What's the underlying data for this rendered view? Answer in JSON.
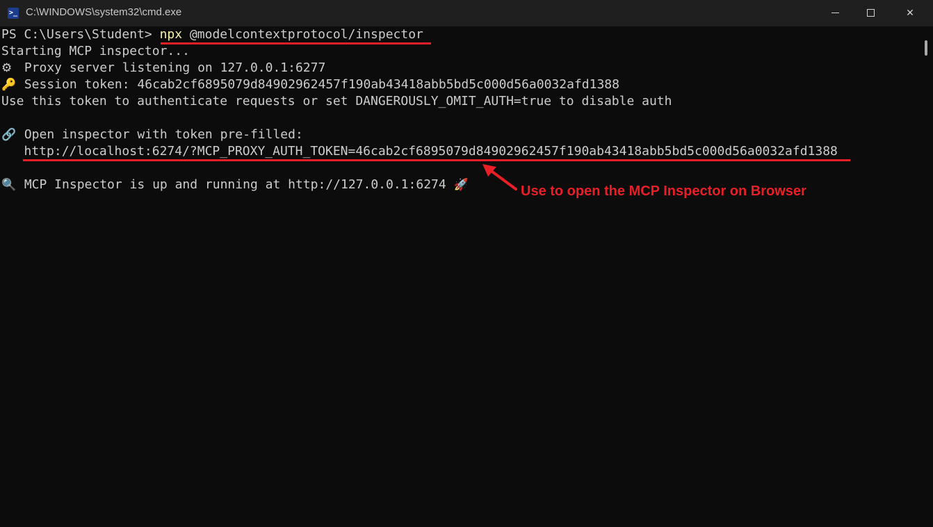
{
  "window": {
    "title": "C:\\WINDOWS\\system32\\cmd.exe",
    "app_icon": "powershell-icon",
    "controls": {
      "minimize": "minimize-icon",
      "maximize": "maximize-icon",
      "close_glyph": "✕"
    }
  },
  "console": {
    "prompt": "PS C:\\Users\\Student> ",
    "command_npx": "npx",
    "command_rest": " @modelcontextprotocol/inspector",
    "line_starting": "Starting MCP inspector...",
    "proxy_icon": "⚙",
    "line_proxy": " Proxy server listening on 127.0.0.1:6277",
    "key_icon": "🔑",
    "line_token": " Session token: 46cab2cf6895079d84902962457f190ab43418abb5bd5c000d56a0032afd1388",
    "line_use_token": "Use this token to authenticate requests or set DANGEROUSLY_OMIT_AUTH=true to disable auth",
    "link_icon": "🔗",
    "line_open": " Open inspector with token pre-filled:",
    "line_url": "   http://localhost:6274/?MCP_PROXY_AUTH_TOKEN=46cab2cf6895079d84902962457f190ab43418abb5bd5c000d56a0032afd1388",
    "search_icon": "🔍",
    "line_running": " MCP Inspector is up and running at http://127.0.0.1:6274 ",
    "rocket_icon": "🚀"
  },
  "annotation": {
    "text": "Use to open the MCP Inspector on Browser",
    "color": "#e81f26"
  },
  "colors": {
    "background": "#0c0c0c",
    "text": "#cccccc",
    "command": "#f9f1a5",
    "titlebar": "#1f1f1f"
  }
}
